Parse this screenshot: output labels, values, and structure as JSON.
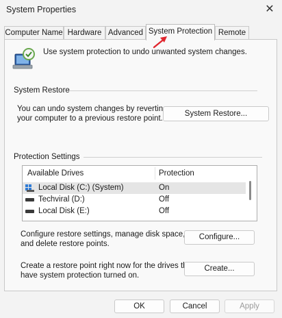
{
  "window": {
    "title": "System Properties",
    "close_glyph": "✕"
  },
  "tabs": [
    {
      "label": "Computer Name",
      "active": false
    },
    {
      "label": "Hardware",
      "active": false
    },
    {
      "label": "Advanced",
      "active": false
    },
    {
      "label": "System Protection",
      "active": true
    },
    {
      "label": "Remote",
      "active": false
    }
  ],
  "intro": {
    "text": "Use system protection to undo unwanted system changes.",
    "icon": "computer-shield-icon"
  },
  "system_restore": {
    "group_label": "System Restore",
    "description_line1": "You can undo system changes by reverting",
    "description_line2": "your computer to a previous restore point.",
    "button_label": "System Restore..."
  },
  "protection": {
    "group_label": "Protection Settings",
    "columns": [
      "Available Drives",
      "Protection"
    ],
    "drives": [
      {
        "name": "Local Disk (C:) (System)",
        "protection": "On",
        "icon": "system-drive-icon",
        "selected": true
      },
      {
        "name": "Techviral (D:)",
        "protection": "Off",
        "icon": "drive-icon",
        "selected": false
      },
      {
        "name": "Local Disk (E:)",
        "protection": "Off",
        "icon": "drive-icon",
        "selected": false
      }
    ],
    "configure_line1": "Configure restore settings, manage disk space,",
    "configure_line2": "and delete restore points.",
    "configure_button": "Configure...",
    "create_line1": "Create a restore point right now for the drives that",
    "create_line2": "have system protection turned on.",
    "create_button": "Create..."
  },
  "footer": {
    "ok": "OK",
    "cancel": "Cancel",
    "apply": "Apply"
  },
  "colors": {
    "annotation_arrow": "#e0262e",
    "window_bg": "#f3f3f3",
    "panel_bg": "#f9f9f9"
  }
}
